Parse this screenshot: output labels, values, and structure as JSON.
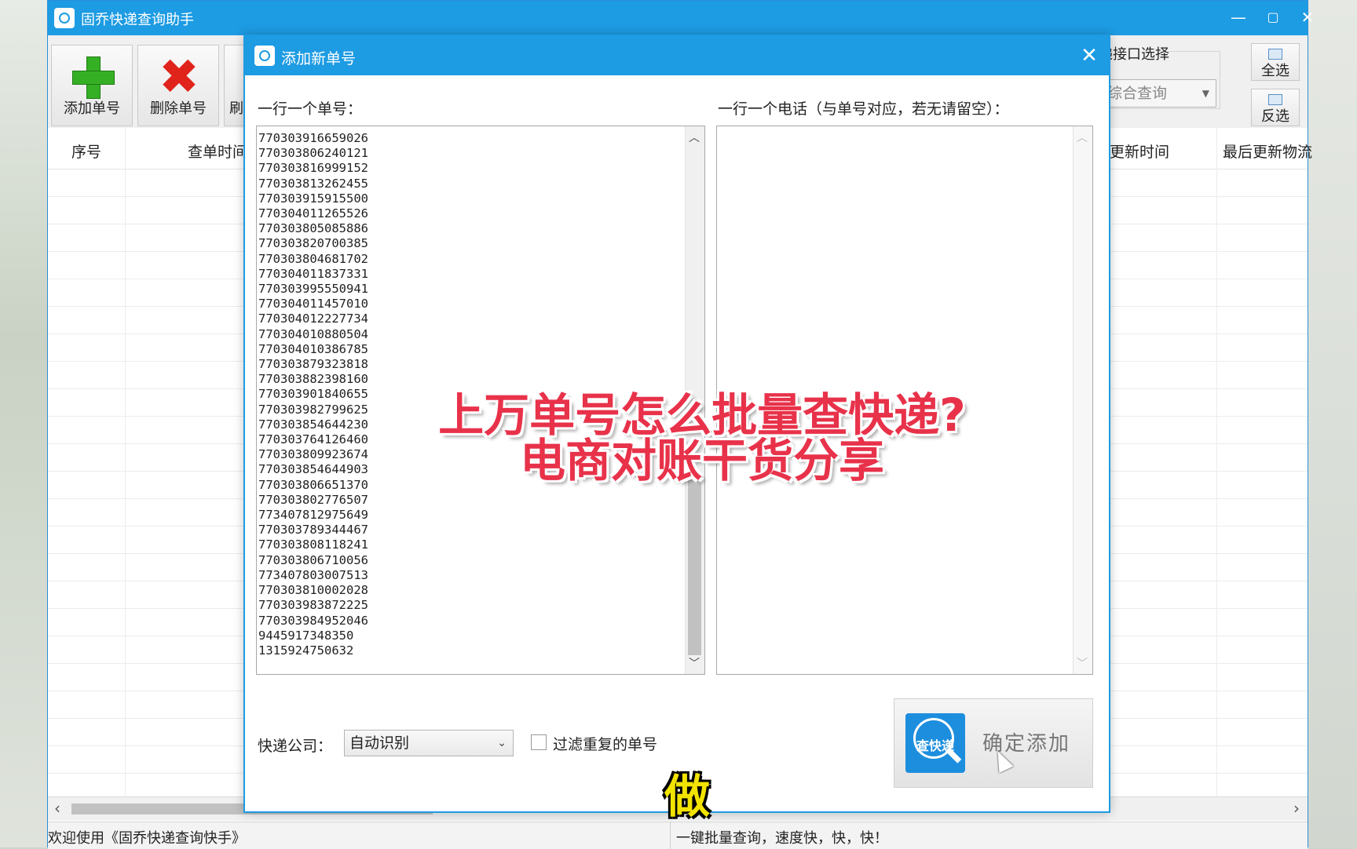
{
  "main_window": {
    "title": "固乔快递查询助手",
    "controls": {
      "minimize": "—",
      "maximize": "▢",
      "close": "✕"
    },
    "toolbar": {
      "add_label": "添加单号",
      "delete_label": "删除单号",
      "partial_label": "刷",
      "api_group_label": "递接口选择",
      "api_select_value": "综合查询",
      "select_all_label": "全选",
      "invert_label": "反选"
    },
    "columns": [
      "序号",
      "查单时间",
      "更新时间",
      "最后更新物流"
    ],
    "status": {
      "left": "欢迎使用《固乔快递查询快手》",
      "right": "一键批量查询，速度快，快，快！"
    }
  },
  "dialog": {
    "title": "添加新单号",
    "left_label": "一行一个单号：",
    "right_label": "一行一个电话（与单号对应，若无请留空）：",
    "tracking_numbers": [
      "770303916659026",
      "770303806240121",
      "770303816999152",
      "770303813262455",
      "770303915915500",
      "770304011265526",
      "770303805085886",
      "770303820700385",
      "770303804681702",
      "770304011837331",
      "770303995550941",
      "770304011457010",
      "770304012227734",
      "770304010880504",
      "770304010386785",
      "770303879323818",
      "770303882398160",
      "770303901840655",
      "770303982799625",
      "770303854644230",
      "770303764126460",
      "770303809923674",
      "770303854644903",
      "770303806651370",
      "770303802776507",
      "773407812975649",
      "770303789344467",
      "770303808118241",
      "770303806710056",
      "773407803007513",
      "770303810002028",
      "770303983872225",
      "770303984952046",
      "9445917348350",
      "1315924750632"
    ],
    "company_label": "快递公司：",
    "company_value": "自动识别",
    "filter_label": "过滤重复的单号",
    "filter_checked": false,
    "logo_text": "查快递",
    "confirm_label": "确定添加"
  },
  "overlay": {
    "caption_line1": "上万单号怎么批量查快递?",
    "caption_line2": "电商对账干货分享",
    "subtitle": "做"
  },
  "colors": {
    "title_bar": "#1d9be3",
    "caption": "#e8324a",
    "subtitle": "#f2e300"
  }
}
